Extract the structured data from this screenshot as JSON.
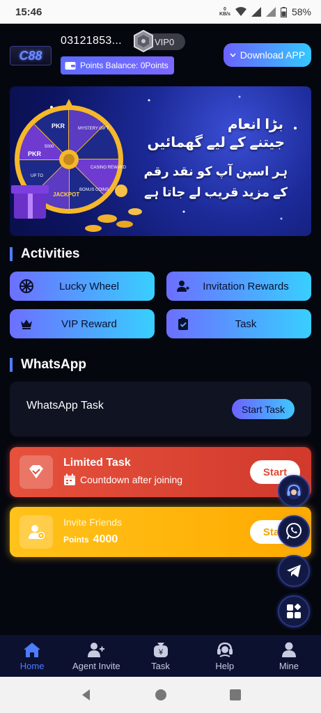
{
  "status_bar": {
    "time": "15:46",
    "net_speed_value": "0",
    "net_speed_unit": "KB/s",
    "battery": "58%"
  },
  "header": {
    "logo_text": "C88",
    "user_id": "03121853...",
    "vip_label": "VIP0",
    "points_balance": "Points Balance: 0Points",
    "download_label": "Download APP"
  },
  "banner": {
    "headline_line1": "بڑا انعام",
    "headline_line2": "جیتنے کے لیے گھمائیں",
    "sub_line1": "ہر اسپن آپ کو نقد رقم",
    "sub_line2": "کے مزید قریب لے جاتا ہے",
    "wheel_labels": [
      "PKR",
      "MYSTERY GIFT",
      "CASINO REWARD",
      "BONUS COINS",
      "JACKPOT",
      "UP TO",
      "PKR",
      "5000"
    ]
  },
  "activities": {
    "title": "Activities",
    "buttons": [
      {
        "label": "Lucky Wheel",
        "icon": "wheel-icon"
      },
      {
        "label": "Invitation Rewards",
        "icon": "user-add-icon"
      },
      {
        "label": "VIP Reward",
        "icon": "crown-icon"
      },
      {
        "label": "Task",
        "icon": "clipboard-check-icon"
      }
    ]
  },
  "whatsapp": {
    "title": "WhatsApp",
    "task_label": "WhatsApp Task",
    "button_label": "Start Task"
  },
  "limited_task": {
    "title": "Limited Task",
    "subtitle": "Countdown after joining",
    "button_label": "Start"
  },
  "invite_friends": {
    "title": "Invite Friends",
    "points_label": "Points",
    "points_value": "4000",
    "button_label": "Start"
  },
  "floating": [
    "headset-icon",
    "whatsapp-icon",
    "telegram-icon",
    "apps-grid-icon"
  ],
  "bottom_nav": [
    {
      "label": "Home",
      "icon": "home-icon",
      "active": true
    },
    {
      "label": "Agent Invite",
      "icon": "agent-add-icon",
      "active": false
    },
    {
      "label": "Task",
      "icon": "money-bag-icon",
      "active": false
    },
    {
      "label": "Help",
      "icon": "support-icon",
      "active": false
    },
    {
      "label": "Mine",
      "icon": "person-icon",
      "active": false
    }
  ],
  "colors": {
    "accent_blue": "#4d7cff",
    "limited_red": "#e24a38",
    "invite_gold": "#ffb800",
    "background": "#05070f"
  }
}
